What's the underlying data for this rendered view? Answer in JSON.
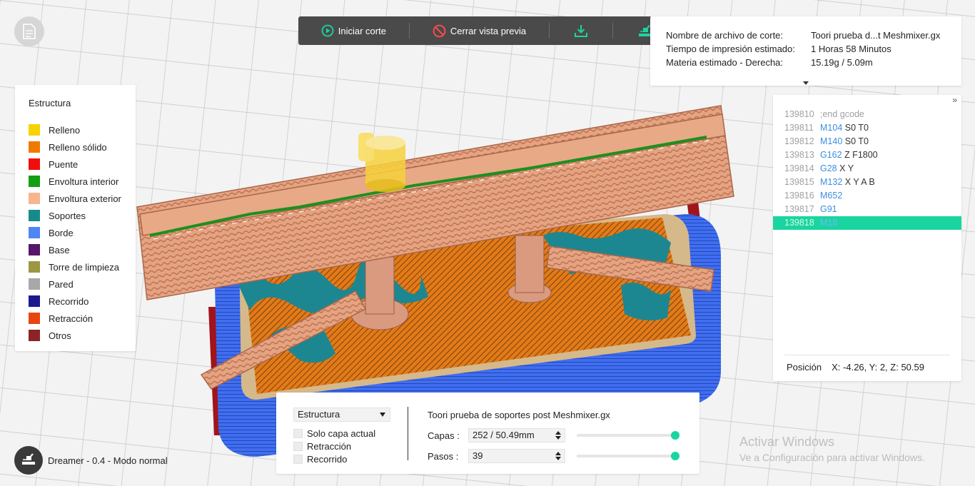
{
  "toolbar": {
    "start_label": "Iniciar corte",
    "close_label": "Cerrar vista previa",
    "export_icon": "download-icon",
    "send_icon": "send-to-printer-icon"
  },
  "info": {
    "rows": [
      {
        "key": "Nombre de archivo de corte:",
        "value": "Toori prueba d...t Meshmixer.gx"
      },
      {
        "key": "Tiempo de impresión estimado:",
        "value": "1 Horas 58 Minutos"
      },
      {
        "key": "Materia estimado - Derecha:",
        "value": "15.19g / 5.09m"
      }
    ]
  },
  "legend": {
    "title": "Estructura",
    "items": [
      {
        "label": "Relleno",
        "color": "#f8d200"
      },
      {
        "label": "Relleno sólido",
        "color": "#f07a00"
      },
      {
        "label": "Puente",
        "color": "#f20d0d"
      },
      {
        "label": "Envoltura interior",
        "color": "#139f13"
      },
      {
        "label": "Envoltura exterior",
        "color": "#f6b58e"
      },
      {
        "label": "Soportes",
        "color": "#178a8c"
      },
      {
        "label": "Borde",
        "color": "#4f85f5"
      },
      {
        "label": "Base",
        "color": "#55166b"
      },
      {
        "label": "Torre de limpieza",
        "color": "#9c9743"
      },
      {
        "label": "Pared",
        "color": "#a8a8a8"
      },
      {
        "label": "Recorrido",
        "color": "#1c1a8e"
      },
      {
        "label": "Retracción",
        "color": "#e6460f"
      },
      {
        "label": "Otros",
        "color": "#8b2424"
      }
    ]
  },
  "gcode": {
    "collapse_label": "»",
    "lines": [
      {
        "num": "139810",
        "cmd": "",
        "comment": ";end gcode",
        "args": ""
      },
      {
        "num": "139811",
        "cmd": "M104",
        "comment": "",
        "args": "S0 T0"
      },
      {
        "num": "139812",
        "cmd": "M140",
        "comment": "",
        "args": "S0 T0"
      },
      {
        "num": "139813",
        "cmd": "G162",
        "comment": "",
        "args": "Z F1800"
      },
      {
        "num": "139814",
        "cmd": "G28",
        "comment": "",
        "args": "X Y"
      },
      {
        "num": "139815",
        "cmd": "M132",
        "comment": "",
        "args": "X Y A B"
      },
      {
        "num": "139816",
        "cmd": "M652",
        "comment": "",
        "args": ""
      },
      {
        "num": "139817",
        "cmd": "G91",
        "comment": "",
        "args": ""
      },
      {
        "num": "139818",
        "cmd": "M18",
        "comment": "",
        "args": ""
      }
    ],
    "active_index": 8,
    "position_label": "Posición",
    "position_value": "X: -4.26, Y: 2, Z: 50.59"
  },
  "controls": {
    "view_select": "Estructura",
    "checkboxes": [
      "Solo capa actual",
      "Retracción",
      "Recorrido"
    ],
    "file_name": "Toori prueba de soportes post Meshmixer.gx",
    "layers_label": "Capas :",
    "layers_value": "252 / 50.49mm",
    "layers_slider": 1.0,
    "steps_label": "Pasos :",
    "steps_value": "39",
    "steps_slider": 1.0
  },
  "machine": {
    "label": "Dreamer - 0.4 - Modo normal"
  },
  "watermark": {
    "title": "Activar Windows",
    "subtitle": "Ve a Configuración para activar Windows."
  }
}
